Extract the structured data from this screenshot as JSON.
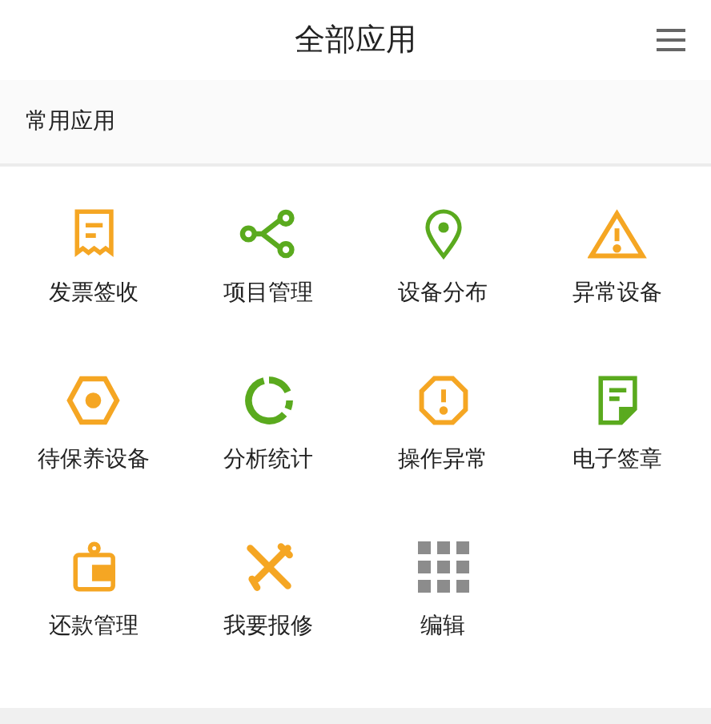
{
  "header": {
    "title": "全部应用"
  },
  "section": {
    "title": "常用应用"
  },
  "apps": [
    {
      "label": "发票签收",
      "kind": "receipt",
      "color": "#f5a623"
    },
    {
      "label": "项目管理",
      "kind": "share",
      "color": "#5aaa1e"
    },
    {
      "label": "设备分布",
      "kind": "pin",
      "color": "#5aaa1e"
    },
    {
      "label": "异常设备",
      "kind": "warning",
      "color": "#f5a623"
    },
    {
      "label": "待保养设备",
      "kind": "hexagon",
      "color": "#f5a623"
    },
    {
      "label": "分析统计",
      "kind": "ring",
      "color": "#5aaa1e"
    },
    {
      "label": "操作异常",
      "kind": "octagon",
      "color": "#f5a623"
    },
    {
      "label": "电子签章",
      "kind": "document",
      "color": "#5aaa1e"
    },
    {
      "label": "还款管理",
      "kind": "wallet",
      "color": "#f5a623"
    },
    {
      "label": "我要报修",
      "kind": "tools",
      "color": "#f5a623"
    },
    {
      "label": "编辑",
      "kind": "grid",
      "color": "#8c8c8c"
    }
  ]
}
